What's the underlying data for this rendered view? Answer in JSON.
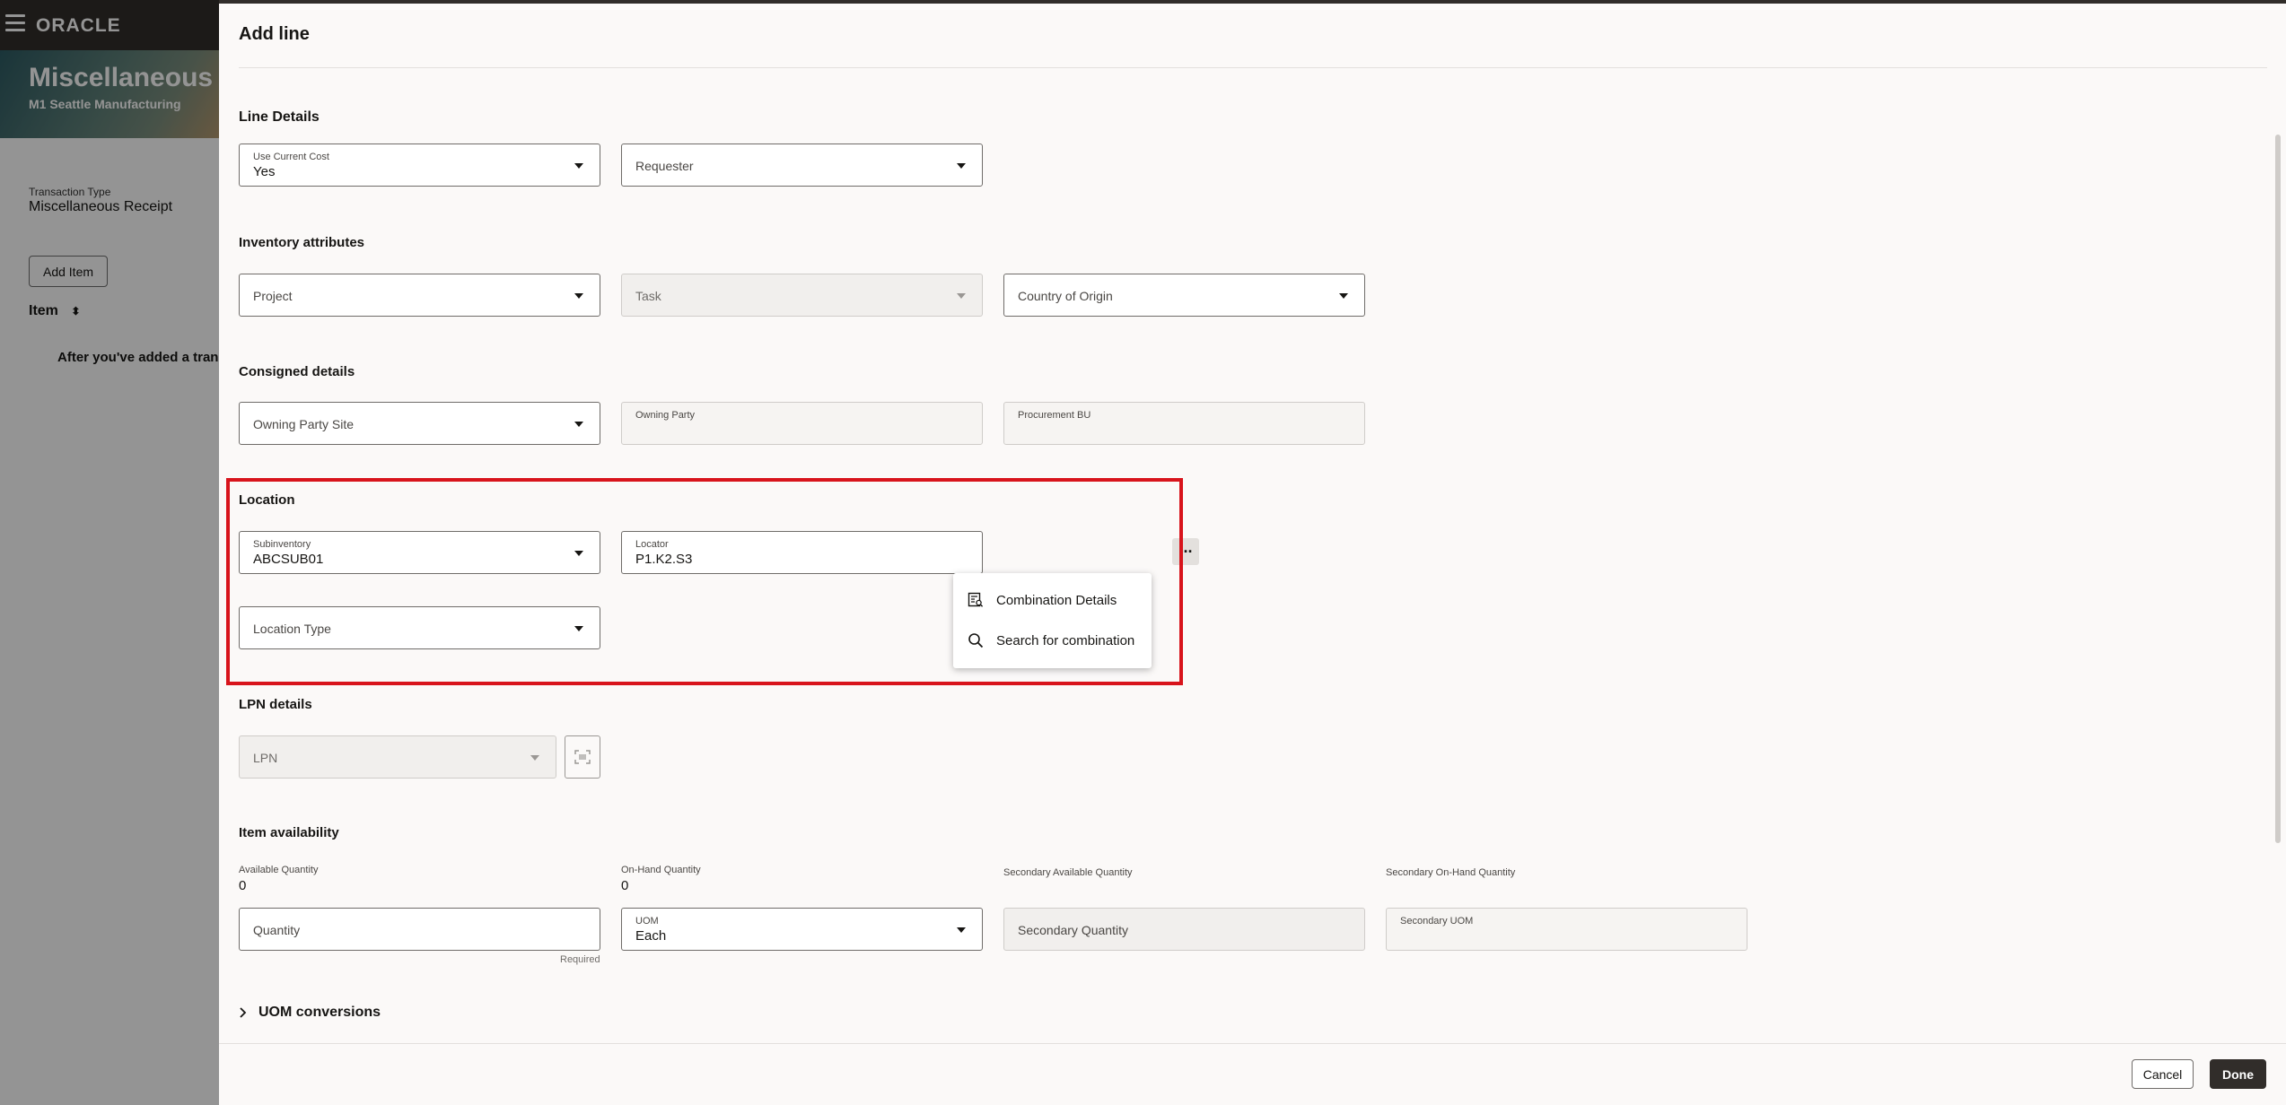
{
  "background": {
    "brand": "ORACLE",
    "page_title": "Miscellaneous Tr",
    "org": "M1 Seattle Manufacturing",
    "transaction_type_label": "Transaction Type",
    "transaction_type_value": "Miscellaneous Receipt",
    "add_item_label": "Add Item",
    "item_column": "Item",
    "empty_message": "After you've added a tran"
  },
  "drawer": {
    "title": "Add line",
    "line_details": {
      "heading": "Line Details",
      "use_current_cost_label": "Use Current Cost",
      "use_current_cost_value": "Yes",
      "requester_placeholder": "Requester"
    },
    "inventory_attributes": {
      "heading": "Inventory attributes",
      "project_placeholder": "Project",
      "task_placeholder": "Task",
      "country_placeholder": "Country of Origin"
    },
    "consigned_details": {
      "heading": "Consigned details",
      "owning_party_site_placeholder": "Owning Party Site",
      "owning_party_label": "Owning Party",
      "procurement_bu_label": "Procurement BU"
    },
    "location": {
      "heading": "Location",
      "subinventory_label": "Subinventory",
      "subinventory_value": "ABCSUB01",
      "locator_label": "Locator",
      "locator_value": "P1.K2.S3",
      "more_button_glyph": "···",
      "location_type_placeholder": "Location Type",
      "menu": [
        {
          "label": "Combination Details",
          "icon": "combination-details-icon"
        },
        {
          "label": "Search for combination",
          "icon": "search-icon"
        }
      ]
    },
    "lpn_details": {
      "heading": "LPN details",
      "lpn_placeholder": "LPN"
    },
    "item_availability": {
      "heading": "Item availability",
      "available_quantity_label": "Available Quantity",
      "available_quantity_value": "0",
      "on_hand_quantity_label": "On-Hand Quantity",
      "on_hand_quantity_value": "0",
      "secondary_available_label": "Secondary Available Quantity",
      "secondary_on_hand_label": "Secondary On-Hand Quantity",
      "quantity_placeholder": "Quantity",
      "required_text": "Required",
      "uom_label": "UOM",
      "uom_value": "Each",
      "secondary_quantity_placeholder": "Secondary Quantity",
      "secondary_uom_label": "Secondary UOM"
    },
    "uom_conversions_label": "UOM conversions",
    "cancel_label": "Cancel",
    "done_label": "Done"
  },
  "colors": {
    "highlight": "#d8141c",
    "topbar": "#312d2a",
    "primary_button": "#312d2a"
  }
}
